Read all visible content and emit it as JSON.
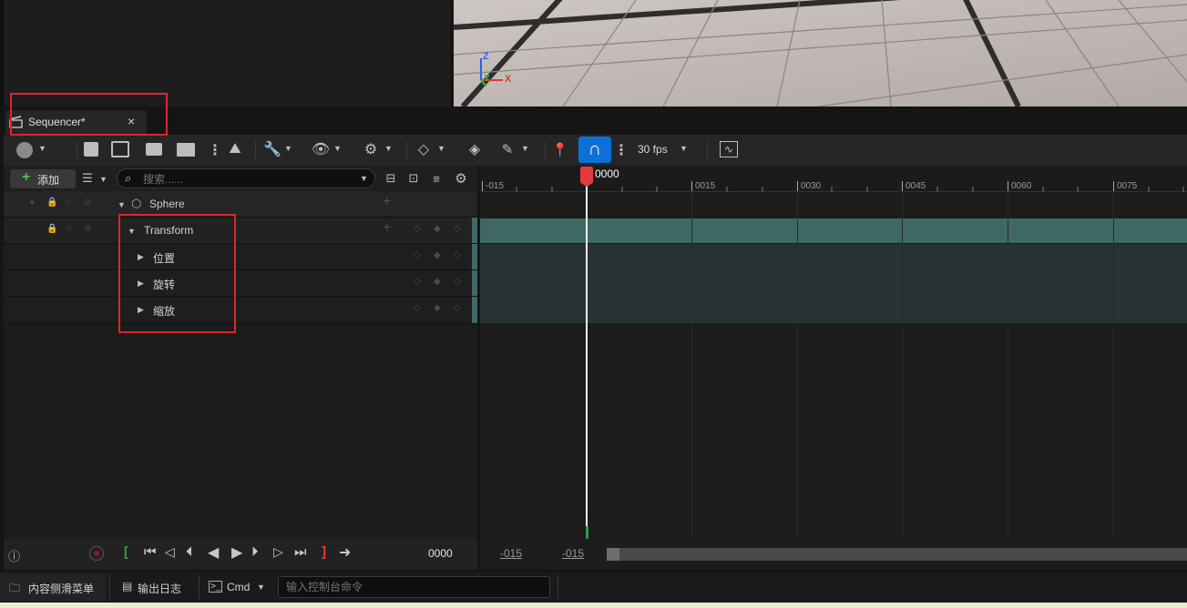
{
  "tab": {
    "title": "Sequencer*",
    "close": "×"
  },
  "viewport": {
    "axis_z": "Z",
    "axis_y": "Y",
    "axis_x": "X"
  },
  "toolbar": {
    "fps_label": "30 fps"
  },
  "outliner": {
    "add_label": "添加",
    "search_placeholder": "搜索......",
    "tracks": [
      {
        "label": "Sphere"
      },
      {
        "label": "Transform"
      },
      {
        "label": "位置"
      },
      {
        "label": "旋转"
      },
      {
        "label": "缩放"
      }
    ]
  },
  "timeline": {
    "playhead_label": "0000",
    "ticks": [
      "-015",
      "0015",
      "0030",
      "0045",
      "0060",
      "0075"
    ]
  },
  "transport": {
    "current_frame": "0000",
    "range_start": "-015",
    "range_end": "-015"
  },
  "statusbar": {
    "content_drawer": "内容侧滑菜单",
    "output_log": "输出日志",
    "cmd_label": "Cmd",
    "console_placeholder": "输入控制台命令"
  },
  "colors": {
    "accent_blue": "#0d70d8",
    "playhead_red": "#e33b3b",
    "track_teal": "#3f6964",
    "highlight_red": "#e0242a"
  }
}
